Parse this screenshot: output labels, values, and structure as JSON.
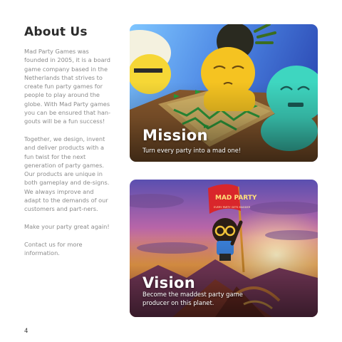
{
  "heading": "About Us",
  "paragraphs": [
    "Mad Party Games was founded in 2005, it is a board game company based in the Netherlands that strives to create fun party games for people to play around the globe. With Mad Party games you can be ensured that han-gouts will be a fun success!",
    "Together, we design, invent and deliver products with a fun twist for the next generation of party games. Our products are unique in both gameplay and de-signs. We always improve and adapt to the demands of our customers and part-ners.",
    "Make your party great again!",
    "Contact us for more information."
  ],
  "page_number": "4",
  "cards": [
    {
      "title": "Mission",
      "text": "Turn every party into a mad one!"
    },
    {
      "title": "Vision",
      "text": "Become the maddest party game producer on this planet."
    }
  ],
  "flag": {
    "brand": "MAD PARTY",
    "tagline": "EVERY PARTY GETS MADDER"
  },
  "colors": {
    "heading": "#2b2b2b",
    "body_text": "#8c8c8c",
    "mission_sky": "#3d6bd6",
    "vision_sunset": "#f2a04a",
    "flag_red": "#d9262b"
  }
}
